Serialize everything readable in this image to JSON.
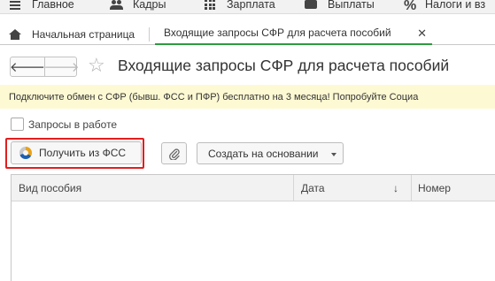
{
  "top_menu": {
    "items": [
      {
        "label": "Главное",
        "icon": "burger-menu-icon"
      },
      {
        "label": "Кадры",
        "icon": "people-icon"
      },
      {
        "label": "Зарплата",
        "icon": "calculator-icon"
      },
      {
        "label": "Выплаты",
        "icon": "wallet-icon"
      },
      {
        "label": "Налоги и вз",
        "icon": "percent-icon",
        "glyph": "%"
      }
    ]
  },
  "tabs": {
    "home_label": "Начальная страница",
    "active_label": "Входящие запросы СФР для расчета пособий",
    "close_glyph": "✕"
  },
  "nav": {
    "back_glyph": "🡐",
    "forward_glyph": "🡒",
    "favorite_glyph": "☆"
  },
  "page": {
    "title": "Входящие запросы СФР для расчета пособий"
  },
  "banner": {
    "text": "Подключите обмен с СФР (бывш. ФСС и ПФР) бесплатно на 3 месяца! Попробуйте Социа"
  },
  "filter": {
    "checkbox_label": "Запросы в работе",
    "checked": false
  },
  "toolbar": {
    "get_from_fss_label": "Получить из ФСС",
    "create_based_on_label": "Создать на основании"
  },
  "table": {
    "columns": [
      "Вид пособия",
      "Дата",
      "Номер"
    ],
    "sort_glyph": "↓",
    "rows": []
  },
  "colors": {
    "highlight": "#e21e1e",
    "active_tab_underline": "#2d9a3e",
    "banner_bg": "#fdf9d3"
  }
}
